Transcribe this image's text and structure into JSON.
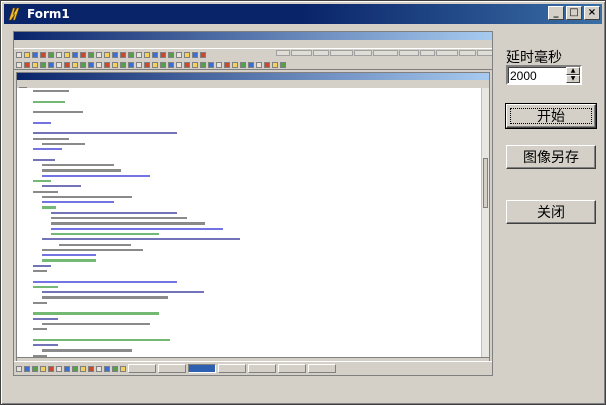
{
  "window": {
    "title": "Form1",
    "minimize_glyph": "_",
    "maximize_glyph": "□",
    "close_glyph": "×"
  },
  "controls": {
    "delay_label": "延时毫秒",
    "delay_value": "2000",
    "start_label": "开始",
    "save_label": "图像另存",
    "close_label": "关闭"
  },
  "colors": {
    "titlebar": "#0a246a",
    "face": "#d4d0c8"
  }
}
